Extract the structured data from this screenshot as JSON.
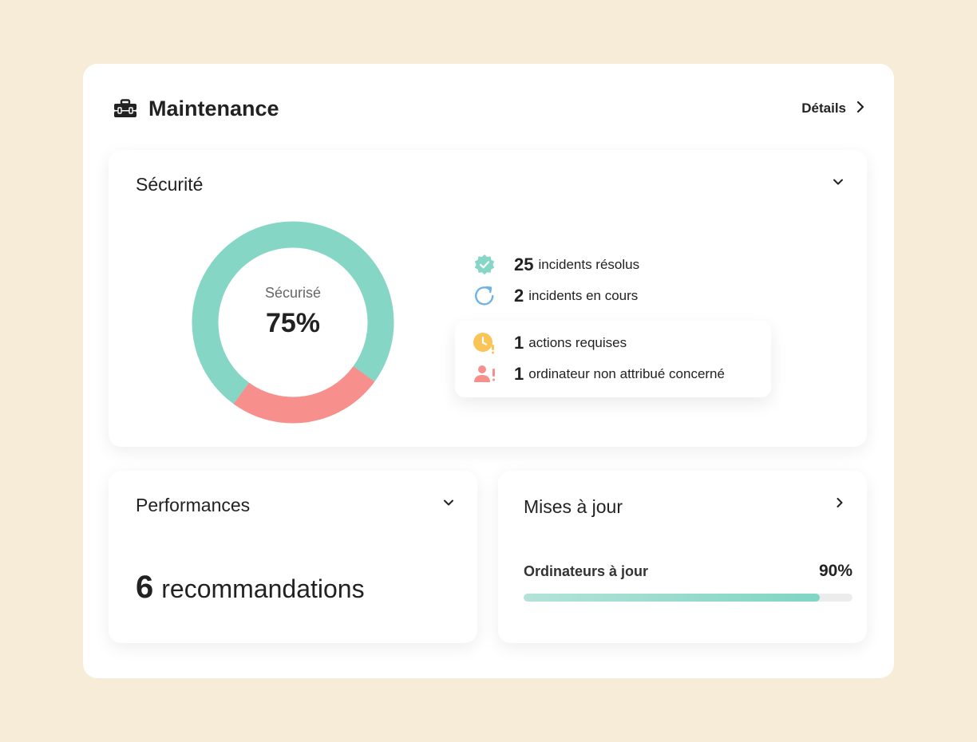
{
  "header": {
    "title": "Maintenance",
    "details_label": "Détails",
    "title_icon": "toolbox-icon"
  },
  "security": {
    "title": "Sécurité",
    "donut": {
      "label": "Sécurisé",
      "value_label": "75%",
      "secure_fraction": 0.75,
      "secure_color": "#86d6c6",
      "insecure_color": "#f7908d"
    },
    "stats": [
      {
        "icon": "badge-check-icon",
        "count": "25",
        "label": "incidents résolus"
      },
      {
        "icon": "refresh-icon",
        "count": "2",
        "label": "incidents en cours"
      }
    ],
    "alerts": [
      {
        "icon": "clock-warning-icon",
        "count": "1",
        "label": "actions requises"
      },
      {
        "icon": "user-alert-icon",
        "count": "1",
        "label": "ordinateur non attribué concerné"
      }
    ]
  },
  "performance": {
    "title": "Performances",
    "count": "6",
    "label": "recommandations"
  },
  "updates": {
    "title": "Mises à jour",
    "label": "Ordinateurs à jour",
    "percent_label": "90%",
    "fraction": 0.9
  }
}
